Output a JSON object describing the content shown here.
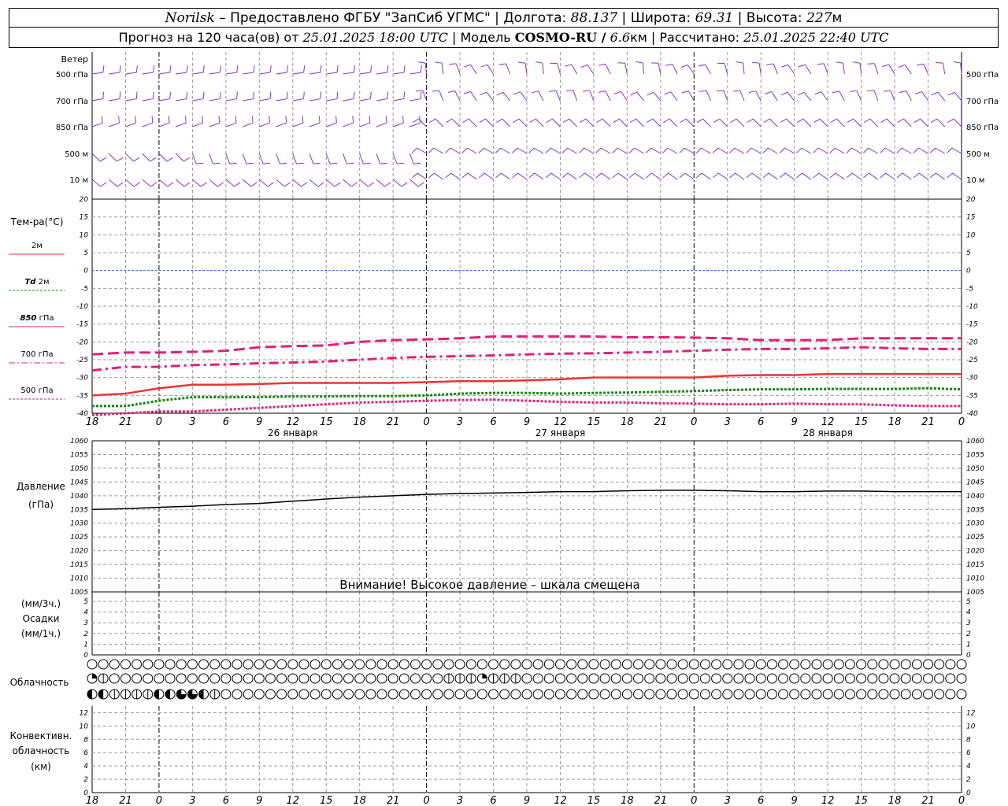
{
  "header": {
    "city": "Norilsk",
    "dash": "–",
    "provider": "Предоставлено ФГБУ \"ЗапСиб УГМС\"",
    "lon_label": "Долгота:",
    "lon_value": "88.137",
    "lat_label": "Широта:",
    "lat_value": "69.31",
    "alt_label": "Высота:",
    "alt_value": "227",
    "alt_unit": "м",
    "sep": "|",
    "forecast_prefix": "Прогноз на 120 часа(ов) от",
    "forecast_date": "25.01.2025 18:00 UTC",
    "model_label": "Модель",
    "model_name": "COSMO-RU /",
    "model_res": "6.6",
    "model_res_unit": "км",
    "calc_label": "Рассчитано:",
    "calc_date": "25.01.2025 22:40 UTC"
  },
  "colors": {
    "t2m": "#ee3333",
    "td2m": "#118811",
    "t850": "#e0207a",
    "t700": "#e0207a",
    "t500": "#e0207a",
    "wind": "#8833cc",
    "zero_line": "#3355ff",
    "pressure": "#000000",
    "grid": "#999999"
  },
  "wind_panel": {
    "title": "Ветер",
    "levels": [
      "500 гПа",
      "700 гПа",
      "850 гПа",
      "500 м",
      "10  м"
    ]
  },
  "temperature_panel": {
    "title": "Тем-ра(°C)",
    "legend": [
      {
        "key": "t2m",
        "label": "2м",
        "style": "solid"
      },
      {
        "key": "td2m",
        "label_italic": "Td",
        "label": " 2м",
        "style": "dotted"
      },
      {
        "key": "t850",
        "label_italic": "850",
        "label": " гПа",
        "style": "solid"
      },
      {
        "key": "t700",
        "label": "700 гПа",
        "style": "dashdot"
      },
      {
        "key": "t500",
        "label": "500 гПа",
        "style": "dotted"
      }
    ],
    "y_ticks": [
      20,
      15,
      10,
      5,
      0,
      -5,
      -10,
      -15,
      -20,
      -25,
      -30,
      -35,
      -40
    ],
    "ylim": [
      -40,
      20
    ]
  },
  "time_axis": {
    "tick_labels": [
      "18",
      "21",
      "0",
      "3",
      "6",
      "9",
      "12",
      "15",
      "18",
      "21",
      "0",
      "3",
      "6",
      "9",
      "12",
      "15",
      "18",
      "21",
      "0",
      "3",
      "6",
      "9",
      "12",
      "15",
      "18",
      "21",
      "0"
    ],
    "day_labels": [
      "26 января",
      "27 января",
      "28 января"
    ]
  },
  "pressure_panel": {
    "title": "Давление",
    "unit": "(гПа)",
    "y_ticks": [
      1060,
      1055,
      1050,
      1045,
      1040,
      1035,
      1030,
      1025,
      1020,
      1015,
      1010,
      1005
    ],
    "ylim": [
      1005,
      1060
    ],
    "warning": "Внимание! Высокое давление – шкала смещена"
  },
  "precip_panel": {
    "unit_top": "(мм/3ч.)",
    "title": "Осадки",
    "unit_bottom": "(мм/1ч.)",
    "y_ticks_left": [
      5,
      4,
      3,
      2,
      1,
      0
    ],
    "y_ticks_right": [
      5,
      4,
      3,
      2,
      1,
      0
    ],
    "ylim": [
      0,
      5
    ]
  },
  "cloud_panel": {
    "title": "Облачность",
    "rows": [
      "0000000000000000000000000000000000000000000000000000000000000000000000000000000000000000000000000000000000",
      "2100000000000000000000000000000011121110000000000000000000000000000000000000000000000000000000000000000000",
      "3311113344310000000000000000000000000000000000000000000000000000000000000000000000000000000000000000000000"
    ]
  },
  "convective_panel": {
    "title_1": "Конвективн.",
    "title_2": "облачность",
    "unit": "(км)",
    "y_ticks": [
      12,
      10,
      8,
      6,
      4,
      2,
      0
    ],
    "ylim": [
      0,
      13
    ]
  },
  "chart_data": [
    {
      "type": "line",
      "title": "Тем-ра(°C)",
      "x_hours": [
        0,
        3,
        6,
        9,
        12,
        15,
        18,
        21,
        24,
        27,
        30,
        33,
        36,
        39,
        42,
        45,
        48,
        51,
        54,
        57,
        60,
        63,
        66,
        69,
        72,
        75,
        78
      ],
      "ylim": [
        -40,
        20
      ],
      "series": [
        {
          "name": "2м",
          "values": [
            -35,
            -34.5,
            -33,
            -32,
            -32,
            -31.8,
            -31.5,
            -31.5,
            -31.5,
            -31.5,
            -31.3,
            -31,
            -31,
            -30.8,
            -30.5,
            -30,
            -30,
            -30,
            -30,
            -29.5,
            -29.3,
            -29.3,
            -29,
            -29,
            -29,
            -29,
            -29
          ]
        },
        {
          "name": "Td 2м",
          "values": [
            -38,
            -38,
            -36.5,
            -35.5,
            -35.5,
            -35.5,
            -35.3,
            -35.3,
            -35.2,
            -35.2,
            -35,
            -34.5,
            -34.3,
            -34.3,
            -34.5,
            -34.3,
            -34.2,
            -34,
            -33.8,
            -33.5,
            -33.3,
            -33.3,
            -33.2,
            -33.2,
            -33.2,
            -33,
            -33.3
          ]
        },
        {
          "name": "850 гПа",
          "values": [
            -23.5,
            -23,
            -23,
            -22.8,
            -22.5,
            -21.5,
            -21.2,
            -21,
            -20,
            -19.5,
            -19.3,
            -19,
            -18.5,
            -18.5,
            -18.5,
            -18.5,
            -18.7,
            -18.7,
            -18.8,
            -19,
            -19.5,
            -19.5,
            -19.5,
            -19,
            -19,
            -19,
            -19
          ]
        },
        {
          "name": "700 гПа",
          "values": [
            -28,
            -27,
            -27,
            -26.5,
            -26.3,
            -26,
            -25.8,
            -25.5,
            -25,
            -24.5,
            -24.2,
            -24,
            -23.8,
            -23.5,
            -23.3,
            -23.2,
            -23,
            -22.8,
            -22.5,
            -22.2,
            -22,
            -22,
            -21.8,
            -21.5,
            -21.8,
            -22,
            -22
          ]
        },
        {
          "name": "500 гПа",
          "values": [
            -40.5,
            -40,
            -39.5,
            -39.5,
            -39,
            -38.5,
            -38,
            -37.5,
            -37,
            -36.8,
            -36.5,
            -36.3,
            -36.2,
            -36.5,
            -36.8,
            -37,
            -37,
            -37.2,
            -37.3,
            -37.5,
            -37.5,
            -37.3,
            -37.5,
            -37.5,
            -37.8,
            -38,
            -38
          ]
        }
      ]
    },
    {
      "type": "line",
      "title": "Давление",
      "x_hours": [
        0,
        3,
        6,
        9,
        12,
        15,
        18,
        21,
        24,
        27,
        30,
        33,
        36,
        39,
        42,
        45,
        48,
        51,
        54,
        57,
        60,
        63,
        66,
        69,
        72,
        75,
        78
      ],
      "ylim": [
        1005,
        1060
      ],
      "series": [
        {
          "name": "Давление",
          "values": [
            1035,
            1035.3,
            1035.8,
            1036.2,
            1036.8,
            1037.2,
            1038,
            1038.8,
            1039.5,
            1040,
            1040.5,
            1040.8,
            1041,
            1041.2,
            1041.5,
            1041.5,
            1041.8,
            1042,
            1042,
            1041.8,
            1041.5,
            1041.5,
            1041.7,
            1041.7,
            1041.5,
            1041.5,
            1041.5
          ]
        }
      ]
    }
  ]
}
